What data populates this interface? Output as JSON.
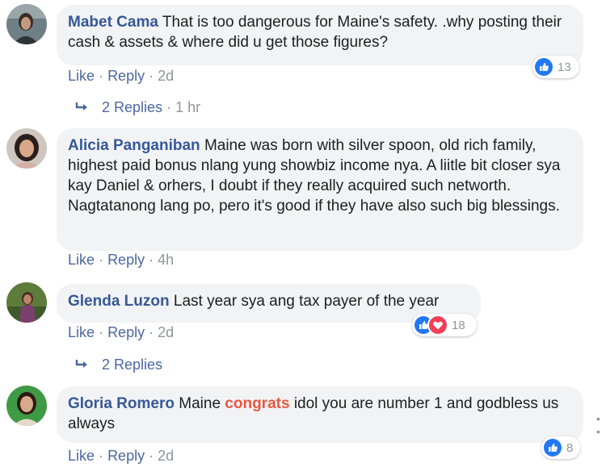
{
  "comments": [
    {
      "author": "Mabet Cama",
      "text": "That is too dangerous for Maine's safety. .why posting their cash & assets & where did u get those figures?",
      "like": "Like",
      "reply": "Reply",
      "sep": "·",
      "time": "2d",
      "reaction_count": "13",
      "replies_label": "2 Replies",
      "replies_time": "1 hr"
    },
    {
      "author": "Alicia Panganiban",
      "text": "Maine was born with silver spoon, old rich family, highest paid bonus nlang yung showbiz income nya. A liitle bit closer sya kay Daniel & orhers, I doubt if they really acquired such networth. Nagtatanong lang po, pero it's good if they have also such big blessings.",
      "like": "Like",
      "reply": "Reply",
      "sep": "·",
      "time": "4h"
    },
    {
      "author": "Glenda Luzon",
      "text": "Last year sya ang tax payer of the year",
      "like": "Like",
      "reply": "Reply",
      "sep": "·",
      "time": "2d",
      "reaction_count": "18",
      "replies_label": "2 Replies"
    },
    {
      "author": "Gloria Romero",
      "text_before": "Maine",
      "text_highlight": "congrats",
      "text_after": "idol you are number 1 and godbless us always",
      "like": "Like",
      "reply": "Reply",
      "sep": "·",
      "time": "2d",
      "reaction_count": "8"
    }
  ],
  "colors": {
    "name": "#365899",
    "link": "#4b67a1",
    "muted": "#90949c",
    "bubble": "#f2f3f5",
    "like_blue": "#2078f4",
    "love_red": "#f33e58",
    "highlight": "#e9573f"
  },
  "icons": {
    "like": "thumbs-up-icon",
    "love": "heart-icon",
    "reply_arrow": "reply-arrow-icon"
  },
  "more_indicator": "• •"
}
